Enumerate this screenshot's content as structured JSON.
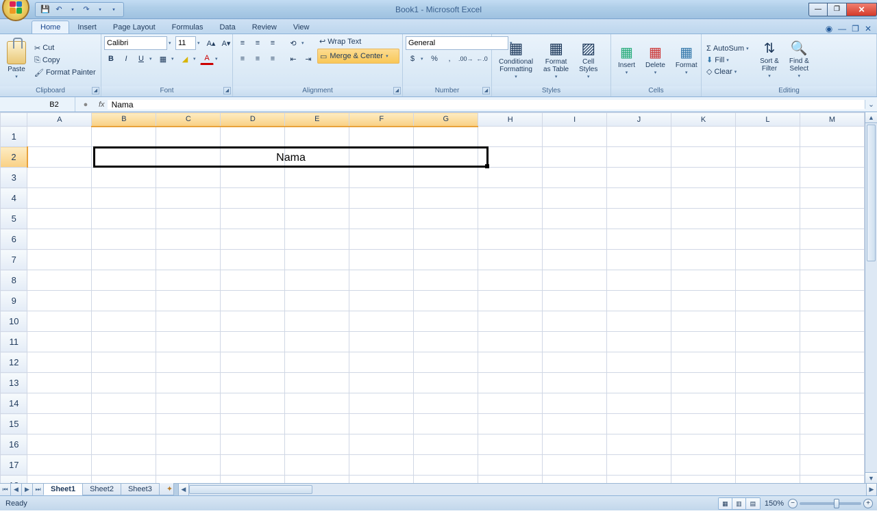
{
  "title": "Book1 - Microsoft Excel",
  "tabs": [
    "Home",
    "Insert",
    "Page Layout",
    "Formulas",
    "Data",
    "Review",
    "View"
  ],
  "activeTab": "Home",
  "clipboard": {
    "label": "Clipboard",
    "paste": "Paste",
    "cut": "Cut",
    "copy": "Copy",
    "formatPainter": "Format Painter"
  },
  "font": {
    "label": "Font",
    "fontName": "Calibri",
    "fontSize": "11"
  },
  "alignment": {
    "label": "Alignment",
    "wrap": "Wrap Text",
    "merge": "Merge & Center"
  },
  "number": {
    "label": "Number",
    "format": "General"
  },
  "styles": {
    "label": "Styles",
    "conditional": "Conditional\nFormatting",
    "formatTable": "Format\nas Table",
    "cellStyles": "Cell\nStyles"
  },
  "cells": {
    "label": "Cells",
    "insert": "Insert",
    "delete": "Delete",
    "format": "Format"
  },
  "editing": {
    "label": "Editing",
    "autosum": "AutoSum",
    "fill": "Fill",
    "clear": "Clear",
    "sort": "Sort &\nFilter",
    "find": "Find &\nSelect"
  },
  "nameBox": "B2",
  "formula": "Nama",
  "columns": [
    "A",
    "B",
    "C",
    "D",
    "E",
    "F",
    "G",
    "H",
    "I",
    "J",
    "K",
    "L",
    "M"
  ],
  "rowCount": 18,
  "selectedCols": [
    1,
    2,
    3,
    4,
    5,
    6
  ],
  "selectedRow": 2,
  "cellValue": "Nama",
  "sheets": [
    "Sheet1",
    "Sheet2",
    "Sheet3"
  ],
  "activeSheet": "Sheet1",
  "status": "Ready",
  "zoom": "150%"
}
